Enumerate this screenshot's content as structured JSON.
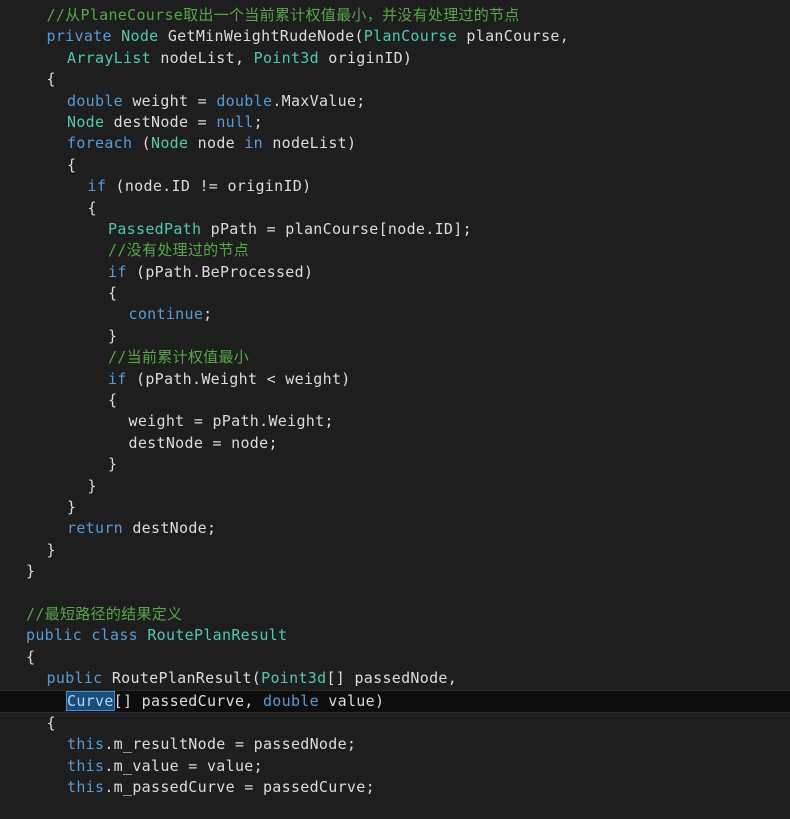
{
  "editor": {
    "language": "csharp",
    "theme": "dark",
    "background_color": "#1e1e1e",
    "current_line_color": "#0d0d0d",
    "selection_color": "#1d4a78",
    "selection_border_color": "#3f8fd4",
    "colors": {
      "keyword": "#569cd6",
      "type": "#4ec9b0",
      "comment": "#57a64a",
      "plain": "#dcdcdc"
    },
    "selected_text": "Curve",
    "current_line_index": 33
  },
  "lines": [
    {
      "indent": 1,
      "current": false,
      "tokens": [
        {
          "c": "cmt",
          "t": "//从PlaneCourse取出一个当前累计权值最小，并没有处理过的节点"
        }
      ]
    },
    {
      "indent": 1,
      "current": false,
      "tokens": [
        {
          "c": "kw",
          "t": "private"
        },
        {
          "c": "pln",
          "t": " "
        },
        {
          "c": "typ",
          "t": "Node"
        },
        {
          "c": "pln",
          "t": " GetMinWeightRudeNode("
        },
        {
          "c": "typ",
          "t": "PlanCourse"
        },
        {
          "c": "pln",
          "t": " planCourse,"
        }
      ]
    },
    {
      "indent": 2,
      "current": false,
      "tokens": [
        {
          "c": "typ",
          "t": "ArrayList"
        },
        {
          "c": "pln",
          "t": " nodeList, "
        },
        {
          "c": "typ",
          "t": "Point3d"
        },
        {
          "c": "pln",
          "t": " originID)"
        }
      ]
    },
    {
      "indent": 1,
      "current": false,
      "tokens": [
        {
          "c": "brc",
          "t": "{"
        }
      ]
    },
    {
      "indent": 2,
      "current": false,
      "tokens": [
        {
          "c": "kw",
          "t": "double"
        },
        {
          "c": "pln",
          "t": " weight = "
        },
        {
          "c": "kw",
          "t": "double"
        },
        {
          "c": "pln",
          "t": ".MaxValue;"
        }
      ]
    },
    {
      "indent": 2,
      "current": false,
      "tokens": [
        {
          "c": "typ",
          "t": "Node"
        },
        {
          "c": "pln",
          "t": " destNode = "
        },
        {
          "c": "kw",
          "t": "null"
        },
        {
          "c": "pln",
          "t": ";"
        }
      ]
    },
    {
      "indent": 2,
      "current": false,
      "tokens": [
        {
          "c": "kw",
          "t": "foreach"
        },
        {
          "c": "pln",
          "t": " ("
        },
        {
          "c": "typ",
          "t": "Node"
        },
        {
          "c": "pln",
          "t": " node "
        },
        {
          "c": "kw",
          "t": "in"
        },
        {
          "c": "pln",
          "t": " nodeList)"
        }
      ]
    },
    {
      "indent": 2,
      "current": false,
      "tokens": [
        {
          "c": "brc",
          "t": "{"
        }
      ]
    },
    {
      "indent": 3,
      "current": false,
      "tokens": [
        {
          "c": "kw",
          "t": "if"
        },
        {
          "c": "pln",
          "t": " (node.ID != originID)"
        }
      ]
    },
    {
      "indent": 3,
      "current": false,
      "tokens": [
        {
          "c": "brc",
          "t": "{"
        }
      ]
    },
    {
      "indent": 4,
      "current": false,
      "tokens": [
        {
          "c": "typ",
          "t": "PassedPath"
        },
        {
          "c": "pln",
          "t": " pPath = planCourse[node.ID];"
        }
      ]
    },
    {
      "indent": 4,
      "current": false,
      "tokens": [
        {
          "c": "cmt",
          "t": "//没有处理过的节点"
        }
      ]
    },
    {
      "indent": 4,
      "current": false,
      "tokens": [
        {
          "c": "kw",
          "t": "if"
        },
        {
          "c": "pln",
          "t": " (pPath.BeProcessed)"
        }
      ]
    },
    {
      "indent": 4,
      "current": false,
      "tokens": [
        {
          "c": "brc",
          "t": "{"
        }
      ]
    },
    {
      "indent": 5,
      "current": false,
      "tokens": [
        {
          "c": "kw",
          "t": "continue"
        },
        {
          "c": "pln",
          "t": ";"
        }
      ]
    },
    {
      "indent": 4,
      "current": false,
      "tokens": [
        {
          "c": "brc",
          "t": "}"
        }
      ]
    },
    {
      "indent": 4,
      "current": false,
      "tokens": [
        {
          "c": "cmt",
          "t": "//当前累计权值最小"
        }
      ]
    },
    {
      "indent": 4,
      "current": false,
      "tokens": [
        {
          "c": "kw",
          "t": "if"
        },
        {
          "c": "pln",
          "t": " (pPath.Weight < weight)"
        }
      ]
    },
    {
      "indent": 4,
      "current": false,
      "tokens": [
        {
          "c": "brc",
          "t": "{"
        }
      ]
    },
    {
      "indent": 5,
      "current": false,
      "tokens": [
        {
          "c": "pln",
          "t": "weight = pPath.Weight;"
        }
      ]
    },
    {
      "indent": 5,
      "current": false,
      "tokens": [
        {
          "c": "pln",
          "t": "destNode = node;"
        }
      ]
    },
    {
      "indent": 4,
      "current": false,
      "tokens": [
        {
          "c": "brc",
          "t": "}"
        }
      ]
    },
    {
      "indent": 3,
      "current": false,
      "tokens": [
        {
          "c": "brc",
          "t": "}"
        }
      ]
    },
    {
      "indent": 2,
      "current": false,
      "tokens": [
        {
          "c": "brc",
          "t": "}"
        }
      ]
    },
    {
      "indent": 2,
      "current": false,
      "tokens": [
        {
          "c": "kw",
          "t": "return"
        },
        {
          "c": "pln",
          "t": " destNode;"
        }
      ]
    },
    {
      "indent": 1,
      "current": false,
      "tokens": [
        {
          "c": "brc",
          "t": "}"
        }
      ]
    },
    {
      "indent": 0,
      "current": false,
      "tokens": [
        {
          "c": "brc",
          "t": "}"
        }
      ]
    },
    {
      "indent": 0,
      "current": false,
      "tokens": []
    },
    {
      "indent": 0,
      "current": false,
      "tokens": [
        {
          "c": "cmt",
          "t": "//最短路径的结果定义"
        }
      ]
    },
    {
      "indent": 0,
      "current": false,
      "tokens": [
        {
          "c": "kw",
          "t": "public"
        },
        {
          "c": "pln",
          "t": " "
        },
        {
          "c": "kw",
          "t": "class"
        },
        {
          "c": "pln",
          "t": " "
        },
        {
          "c": "typ",
          "t": "RoutePlanResult"
        }
      ]
    },
    {
      "indent": 0,
      "current": false,
      "tokens": [
        {
          "c": "brc",
          "t": "{"
        }
      ]
    },
    {
      "indent": 1,
      "current": false,
      "tokens": [
        {
          "c": "kw",
          "t": "public"
        },
        {
          "c": "pln",
          "t": " RoutePlanResult("
        },
        {
          "c": "typ",
          "t": "Point3d"
        },
        {
          "c": "pln",
          "t": "[] passedNode,"
        }
      ]
    },
    {
      "indent": 2,
      "current": true,
      "tokens": [
        {
          "c": "typ sel",
          "t": "Curve"
        },
        {
          "c": "pln",
          "t": "[] passedCurve, "
        },
        {
          "c": "kw",
          "t": "double"
        },
        {
          "c": "pln",
          "t": " value)"
        }
      ]
    },
    {
      "indent": 1,
      "current": false,
      "tokens": [
        {
          "c": "brc",
          "t": "{"
        }
      ]
    },
    {
      "indent": 2,
      "current": false,
      "tokens": [
        {
          "c": "kw",
          "t": "this"
        },
        {
          "c": "pln",
          "t": ".m_resultNode = passedNode;"
        }
      ]
    },
    {
      "indent": 2,
      "current": false,
      "tokens": [
        {
          "c": "kw",
          "t": "this"
        },
        {
          "c": "pln",
          "t": ".m_value = value;"
        }
      ]
    },
    {
      "indent": 2,
      "current": false,
      "tokens": [
        {
          "c": "kw",
          "t": "this"
        },
        {
          "c": "pln",
          "t": ".m_passedCurve = passedCurve;"
        }
      ]
    }
  ]
}
